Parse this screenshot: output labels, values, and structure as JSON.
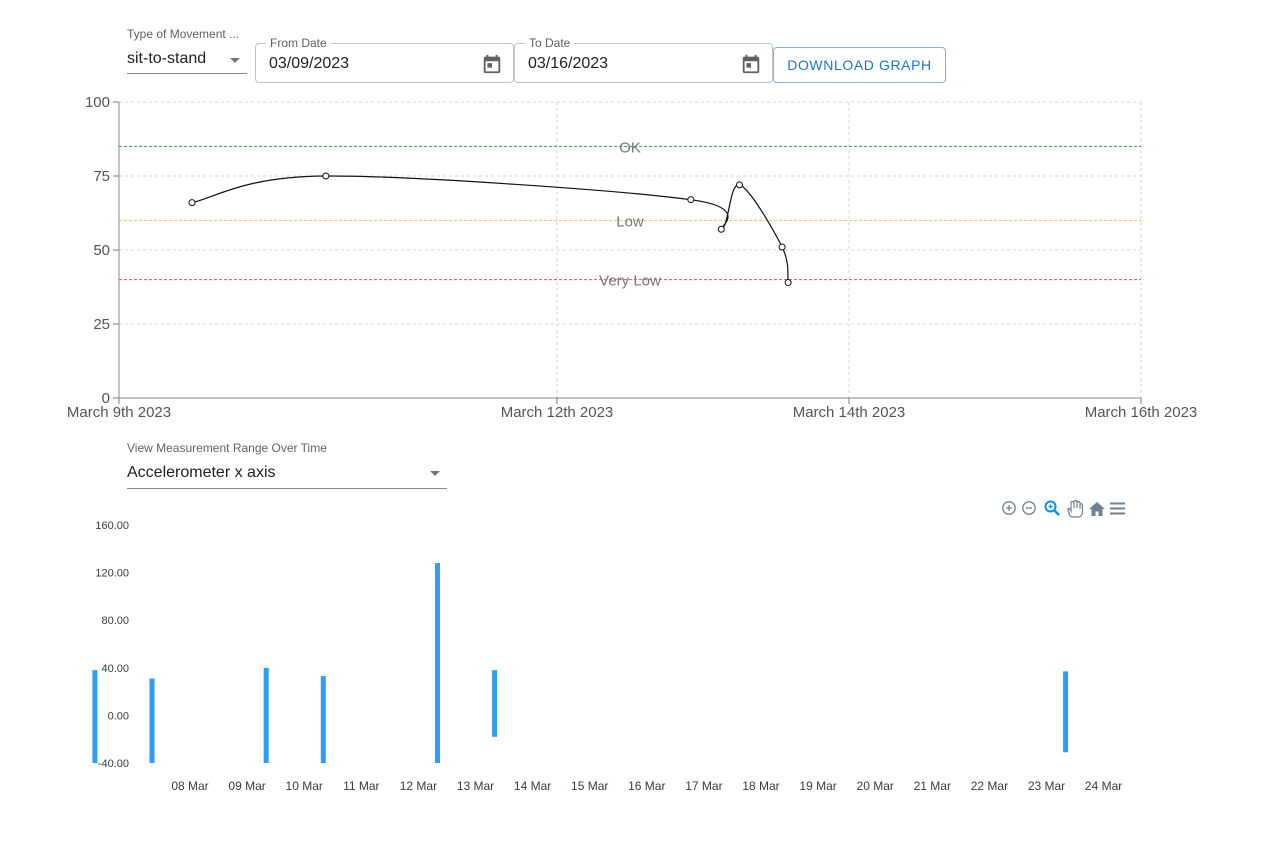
{
  "filters": {
    "movement_type": {
      "label": "Type of Movement ...",
      "value": "sit-to-stand"
    },
    "from_date": {
      "label": "From Date",
      "value": "03/09/2023"
    },
    "to_date": {
      "label": "To Date",
      "value": "03/16/2023"
    },
    "download_label": "DOWNLOAD GRAPH"
  },
  "measurement": {
    "label": "View Measurement Range Over Time",
    "value": "Accelerometer x axis"
  },
  "toolbar": {
    "icons": [
      "zoom-in-icon",
      "zoom-out-icon",
      "selection-zoom-icon",
      "pan-icon",
      "reset-home-icon",
      "menu-icon"
    ]
  },
  "colors": {
    "ok": "#2e9e44",
    "low": "#f2c14e",
    "very_low": "#e0505a",
    "bar": "#2e9ef5",
    "line": "#111111",
    "accent": "#1976d2"
  },
  "chart_data": [
    {
      "type": "line",
      "title": "",
      "xlabel": "",
      "ylabel": "",
      "ylim": [
        0,
        100
      ],
      "xlim": [
        "2023-03-09",
        "2023-03-16"
      ],
      "x_tick_labels": [
        "March 9th 2023",
        "March 12th 2023",
        "March 14th 2023",
        "March 16th 2023"
      ],
      "y_ticks": [
        0,
        25,
        50,
        75,
        100
      ],
      "grid": true,
      "thresholds": [
        {
          "label": "OK",
          "value": 85
        },
        {
          "label": "Low",
          "value": 60
        },
        {
          "label": "Very Low",
          "value": 40
        }
      ],
      "series": [
        {
          "x": [
            "2023-03-09 12:00",
            "2023-03-10 10:00",
            "2023-03-12 22:00",
            "2023-03-13 03:00",
            "2023-03-13 06:00",
            "2023-03-13 13:00",
            "2023-03-13 14:00"
          ],
          "values": [
            66,
            75,
            67,
            57,
            72,
            51,
            39
          ]
        }
      ]
    },
    {
      "type": "bar",
      "title": "",
      "xlabel": "",
      "ylabel": "",
      "ylim": [
        -40,
        160
      ],
      "y_tick_labels": [
        "-40.00",
        "0.00",
        "40.00",
        "80.00",
        "120.00",
        "160.00"
      ],
      "x_tick_labels": [
        "08 Mar",
        "09 Mar",
        "10 Mar",
        "11 Mar",
        "12 Mar",
        "13 Mar",
        "14 Mar",
        "15 Mar",
        "16 Mar",
        "17 Mar",
        "18 Mar",
        "19 Mar",
        "20 Mar",
        "21 Mar",
        "22 Mar",
        "23 Mar",
        "24 Mar"
      ],
      "grid": false,
      "bars": [
        {
          "x": "07 Mar",
          "low": -40,
          "high": 38
        },
        {
          "x": "08 Mar",
          "low": -40,
          "high": 31
        },
        {
          "x": "10 Mar",
          "low": -40,
          "high": 40
        },
        {
          "x": "11 Mar",
          "low": -40,
          "high": 33
        },
        {
          "x": "13 Mar",
          "low": -40,
          "high": 128
        },
        {
          "x": "14 Mar",
          "low": -18,
          "high": 38
        },
        {
          "x": "24 Mar",
          "low": -31,
          "high": 37
        }
      ]
    }
  ]
}
